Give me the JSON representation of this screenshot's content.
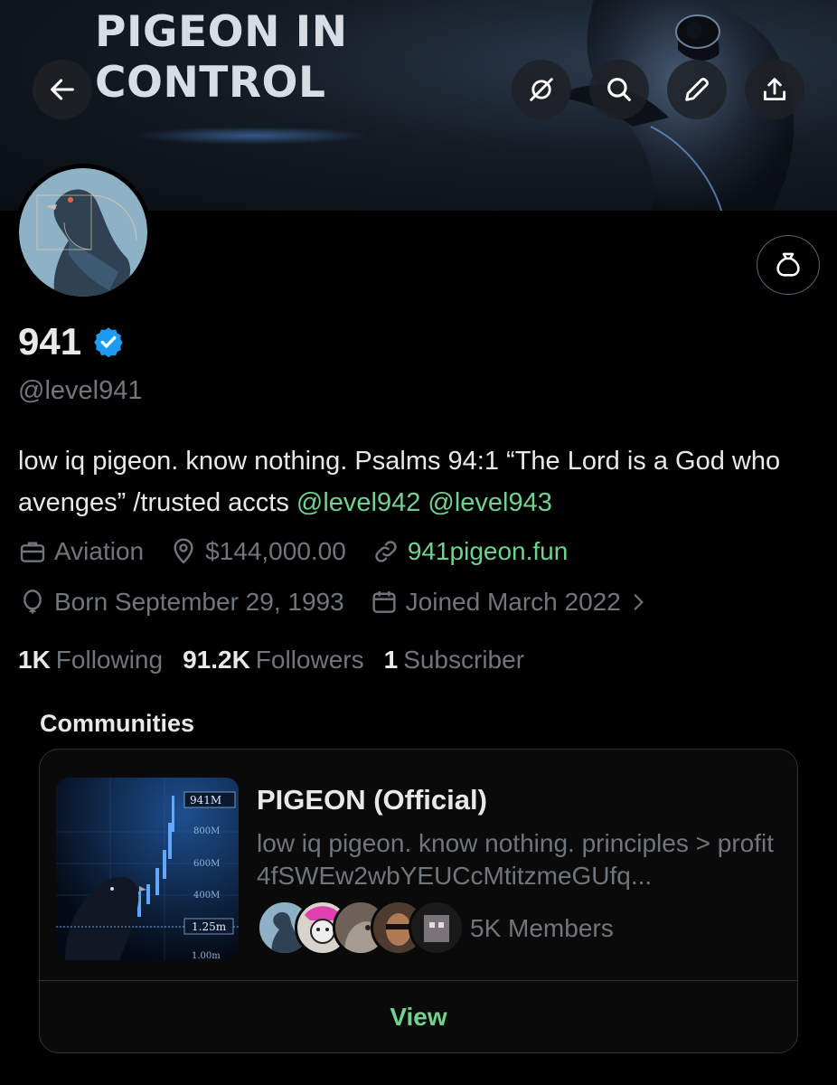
{
  "banner": {
    "title_line1": "PIGEON IN",
    "title_line2": "CONTROL"
  },
  "header": {
    "back_icon": "arrow-left-icon",
    "actions": [
      "grok-icon",
      "search-icon",
      "pencil-icon",
      "share-icon"
    ]
  },
  "profile": {
    "display_name": "941",
    "verified": true,
    "handle": "@level941",
    "bio_text": "low iq pigeon. know nothing. Psalms 94:1 “The Lord is a God who avenges” /trusted accts ",
    "bio_mentions": [
      "@level942",
      "@level943"
    ],
    "category": "Aviation",
    "location": "$144,000.00",
    "website": "941pigeon.fun",
    "birthday": "Born September 29, 1993",
    "joined": "Joined March 2022",
    "subscribe_icon": "money-bag-icon"
  },
  "stats": {
    "following_count": "1K",
    "following_label": "Following",
    "followers_count": "91.2K",
    "followers_label": "Followers",
    "subscriber_count": "1",
    "subscriber_label": "Subscriber"
  },
  "communities": {
    "heading": "Communities",
    "card": {
      "name": "PIGEON (Official)",
      "description": "low iq pigeon. know nothing. principles > profit 4fSWEw2wbYEUCcMtitzmeGUfq...",
      "members": "5K Members",
      "view_label": "View",
      "thumb_labels": [
        "941M",
        "800M",
        "600M",
        "400M",
        "1.25m",
        "1.00m"
      ]
    }
  },
  "colors": {
    "accent_green": "#6fd38f",
    "verified_blue": "#1d9bf0",
    "muted_text": "#71767b"
  }
}
